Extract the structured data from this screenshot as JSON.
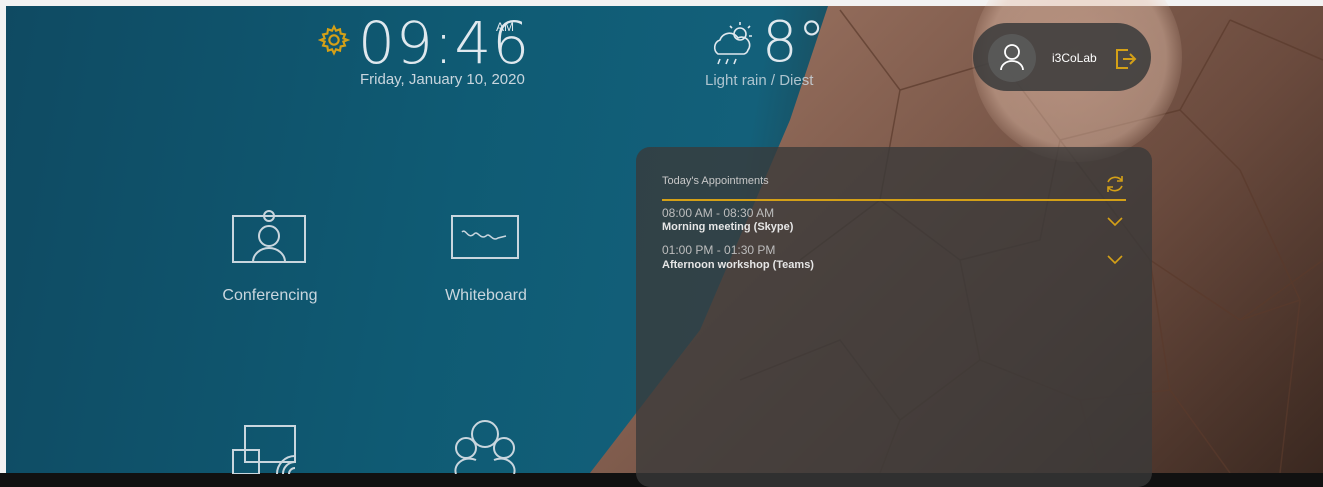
{
  "clock": {
    "time": "09:46",
    "ampm": "AM",
    "date": "Friday, January 10, 2020"
  },
  "weather": {
    "temp": "8°",
    "description": "Light rain / Diest",
    "icon": "cloud-rain-sun-icon"
  },
  "user": {
    "name": "i3CoLab",
    "avatar_icon": "user-icon",
    "logout_icon": "logout-icon"
  },
  "apps": [
    {
      "label": "Conferencing",
      "icon": "webcam-icon"
    },
    {
      "label": "Whiteboard",
      "icon": "whiteboard-icon"
    },
    {
      "label": "",
      "icon": "screen-share-icon"
    },
    {
      "label": "",
      "icon": "people-group-icon"
    }
  ],
  "appointments": {
    "title": "Today's Appointments",
    "items": [
      {
        "time": "08:00 AM - 08:30 AM",
        "title": "Morning meeting (Skype)"
      },
      {
        "time": "01:00 PM - 01:30 PM",
        "title": "Afternoon workshop (Teams)"
      }
    ]
  },
  "colors": {
    "accent": "#d4a017",
    "background": "#0f5b74",
    "panel": "#3a3a3a"
  }
}
